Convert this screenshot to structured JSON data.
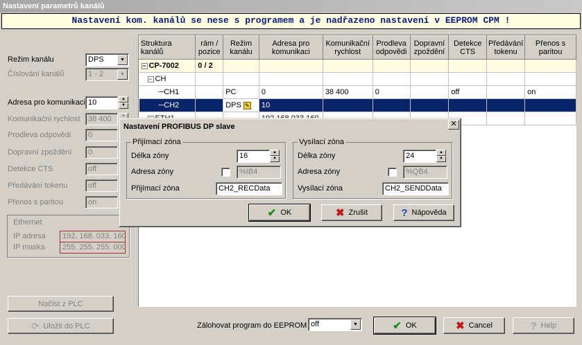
{
  "window": {
    "title": "Nastavení parametrů kanálů"
  },
  "banner": "Nastavení kom. kanálů se nese s programem a je nadřazeno nastavení v EEPROM CPM !",
  "left": {
    "rezim_label": "Režim kanálu",
    "rezim_value": "DPS",
    "cislovani_label": "Číslování kanálů",
    "cislovani_value": "1 - 2",
    "adresa_label": "Adresa pro komunikaci",
    "adresa_value": "10",
    "rychlost_label": "Komunikační rychlost",
    "rychlost_value": "38 400",
    "prodleva_label": "Prodleva odpovědi",
    "prodleva_value": "0",
    "zpozdeni_label": "Dopravní zpoždění",
    "zpozdeni_value": "0",
    "cts_label": "Detekce CTS",
    "cts_value": "off",
    "token_label": "Předávání tokenu",
    "token_value": "off",
    "parita_label": "Přenos s paritou",
    "parita_value": "on",
    "ethernet_title": "Ethernet",
    "ip_label": "IP adresa",
    "ip_value": "192. 168. 033. 160",
    "mask_label": "IP maska",
    "mask_value": "255. 255. 255. 000",
    "nacist_button": "Načíst z PLC",
    "ulozit_button": "Uložit do PLC"
  },
  "grid": {
    "columns": [
      "Struktura kanálů",
      "rám / pozice",
      "Režim kanálu",
      "Adresa pro komunikaci",
      "Komunikační rychlost",
      "Prodleva odpovědi",
      "Dopravní zpoždění",
      "Detekce CTS",
      "Předávání tokenu",
      "Přenos s paritou"
    ],
    "rows": [
      {
        "tree": "CP-7002",
        "pos": "0 / 2",
        "rezim": "",
        "adresa": "",
        "rychlost": "",
        "prodleva": "",
        "zpozdeni": "",
        "cts": "",
        "token": "",
        "parita": ""
      },
      {
        "tree": "CH",
        "pos": "",
        "rezim": "",
        "adresa": "",
        "rychlost": "",
        "prodleva": "",
        "zpozdeni": "",
        "cts": "",
        "token": "",
        "parita": ""
      },
      {
        "tree": "CH1",
        "pos": "",
        "rezim": "PC",
        "adresa": "0",
        "rychlost": "38 400",
        "prodleva": "0",
        "zpozdeni": "",
        "cts": "off",
        "token": "",
        "parita": "on"
      },
      {
        "tree": "CH2",
        "pos": "",
        "rezim": "DPS",
        "adresa": "10",
        "rychlost": "",
        "prodleva": "",
        "zpozdeni": "",
        "cts": "",
        "token": "",
        "parita": ""
      },
      {
        "tree": "ETH1",
        "pos": "",
        "rezim": "",
        "adresa": "192.168.033.160",
        "rychlost": "",
        "prodleva": "",
        "zpozdeni": "",
        "cts": "",
        "token": "",
        "parita": ""
      }
    ]
  },
  "bottom": {
    "zalohovat_label": "Zálohovat program do EEPROM",
    "zalohovat_value": "off",
    "ok_button": "OK",
    "cancel_button": "Cancel",
    "help_button": "Help"
  },
  "dialog": {
    "title": "Nastavení PROFIBUS DP slave",
    "rx_group": "Přijímací zóna",
    "rx_delka_label": "Délka zóny",
    "rx_delka_value": "16",
    "rx_adresa_label": "Adresa zóny",
    "rx_adresa_value": "%IB4",
    "rx_zona_label": "Přijímací zóna",
    "rx_zona_value": "CH2_RECData",
    "tx_group": "Vysílací zóna",
    "tx_delka_label": "Délka zóny",
    "tx_delka_value": "24",
    "tx_adresa_label": "Adresa zóny",
    "tx_adresa_value": "%QB4",
    "tx_zona_label": "Vysílací zóna",
    "tx_zona_value": "CH2_SENDData",
    "ok_button": "OK",
    "zrusit_button": "Zrušit",
    "napoveda_button": "Nápověda"
  }
}
